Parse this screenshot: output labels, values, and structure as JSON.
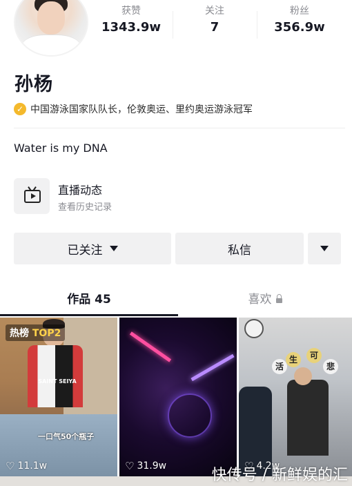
{
  "profile": {
    "name": "孙杨",
    "verification": "中国游泳国家队队长，伦敦奥运、里约奥运游泳冠军",
    "bio": "Water is my DNA"
  },
  "stats": [
    {
      "label": "获赞",
      "value": "1343.9w"
    },
    {
      "label": "关注",
      "value": "7"
    },
    {
      "label": "粉丝",
      "value": "356.9w"
    }
  ],
  "live": {
    "title": "直播动态",
    "subtitle": "查看历史记录"
  },
  "actions": {
    "follow": "已关注",
    "message": "私信"
  },
  "tabs": {
    "works": "作品 45",
    "likes": "喜欢"
  },
  "videos": [
    {
      "likes": "11.1w",
      "badge_prefix": "热榜 ",
      "badge_rank": "TOP2",
      "caption": "一口气50个瓶子",
      "shirt_text": "SAINT SEIYA"
    },
    {
      "likes": "31.9w"
    },
    {
      "likes": "4.2w",
      "stickers": [
        "生",
        "活",
        "可",
        "悲"
      ]
    }
  ],
  "watermark": "快传号 / 新鲜娱的汇",
  "colors": {
    "verify_badge": "#f4b92c",
    "active_tab": "#161823",
    "hot_rank": "#ffd24a"
  }
}
